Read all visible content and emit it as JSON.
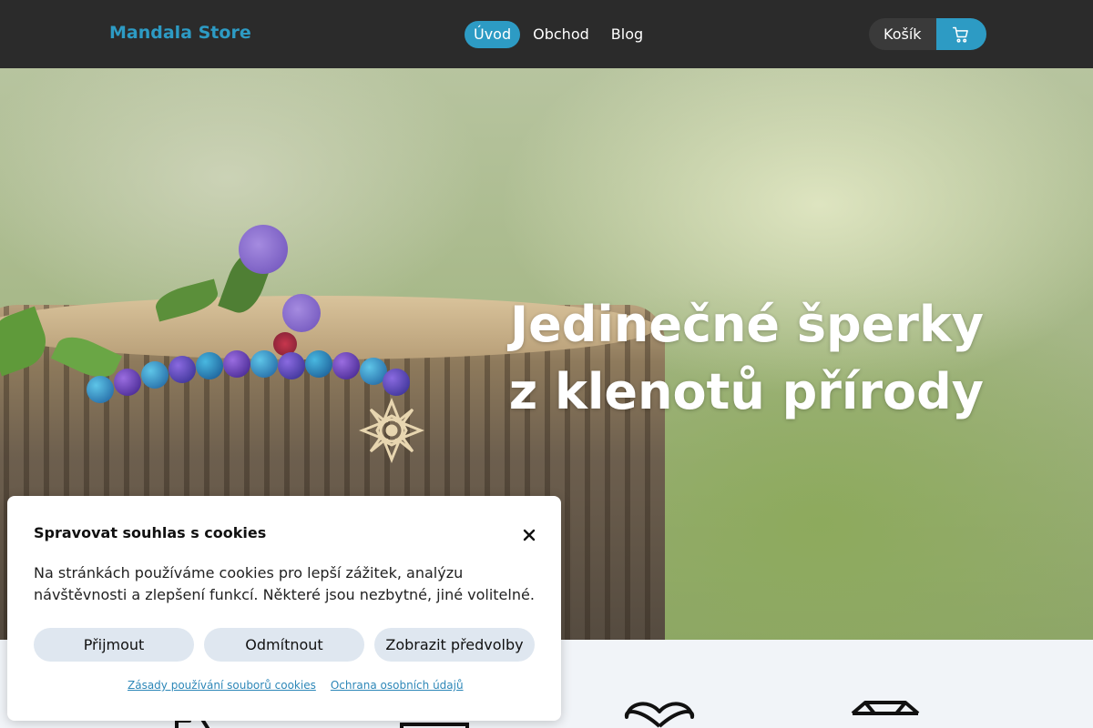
{
  "header": {
    "brand": "Mandala Store",
    "nav": [
      "Úvod",
      "Obchod",
      "Blog"
    ],
    "cart_label": "Košík"
  },
  "hero": {
    "title_line1": "Jedinečné šperky",
    "title_line2": "z klenotů přírody"
  },
  "cookie_dialog": {
    "title": "Spravovat souhlas s cookies",
    "text": "Na stránkách používáme cookies pro lepší zážitek, analýzu návštěvnosti a zlepšení funkcí. Některé jsou nezbytné, jiné volitelné.",
    "buttons": {
      "accept": "Přijmout",
      "reject": "Odmítnout",
      "preferences": "Zobrazit předvolby"
    },
    "links": {
      "cookie_policy": "Zásady používání souborů cookies",
      "privacy": "Ochrana osobních údajů"
    }
  },
  "colors": {
    "accent": "#2d9bc4",
    "header_bg": "#2b2b2b"
  },
  "icons": [
    "cart-icon",
    "close-icon",
    "heart-icon",
    "diamond-icon"
  ]
}
